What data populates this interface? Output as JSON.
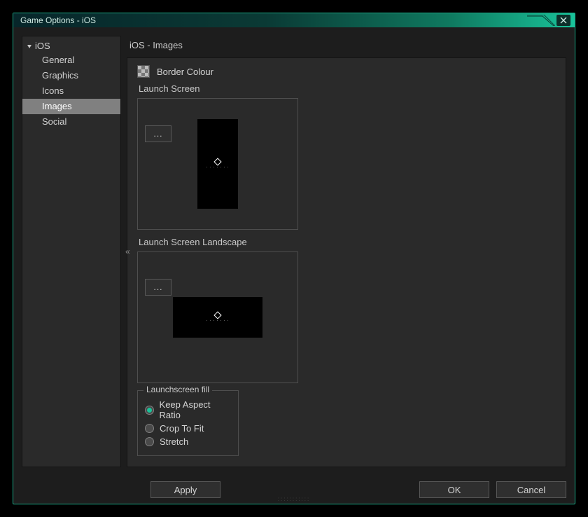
{
  "window": {
    "title": "Game Options - iOS",
    "close_icon": "close"
  },
  "sidebar": {
    "root": "iOS",
    "items": [
      {
        "label": "General"
      },
      {
        "label": "Graphics"
      },
      {
        "label": "Icons"
      },
      {
        "label": "Images",
        "selected": true
      },
      {
        "label": "Social"
      }
    ]
  },
  "collapse_glyph": "«",
  "main": {
    "header": "iOS - Images",
    "border_colour_label": "Border Colour",
    "launch_screen_label": "Launch Screen",
    "launch_screen_landscape_label": "Launch Screen Landscape",
    "browse_label": "...",
    "fill_group": {
      "legend": "Launchscreen fill",
      "options": [
        {
          "label": "Keep Aspect Ratio",
          "checked": true
        },
        {
          "label": "Crop To Fit",
          "checked": false
        },
        {
          "label": "Stretch",
          "checked": false
        }
      ]
    }
  },
  "buttons": {
    "apply": "Apply",
    "ok": "OK",
    "cancel": "Cancel"
  }
}
